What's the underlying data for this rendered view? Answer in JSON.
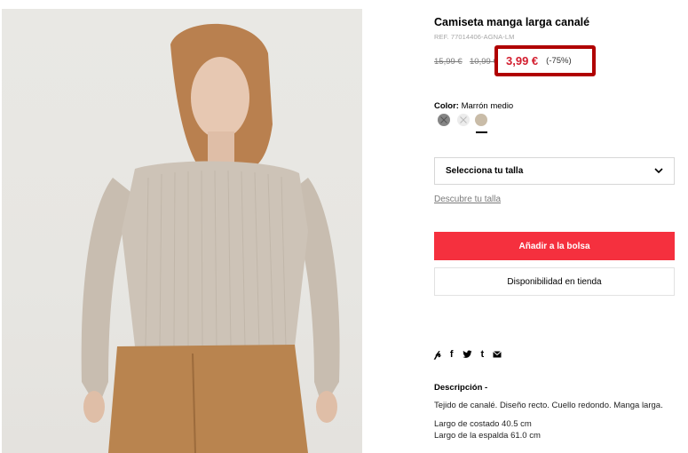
{
  "product": {
    "title": "Camiseta manga larga canalé",
    "ref": "REF. 77014406-AGNA-LM",
    "price_original": "15,99 €",
    "price_previous": "10,99 €",
    "price_current": "3,99 €",
    "discount": "(-75%)"
  },
  "color": {
    "label": "Color:",
    "value": "Marrón medio",
    "swatches": [
      "#858585",
      "#ececec",
      "#c9bca8"
    ]
  },
  "size": {
    "select_label": "Selecciona tu talla",
    "discover_link": "Descubre tu talla"
  },
  "actions": {
    "add_to_bag": "Añadir a la bolsa",
    "store_availability": "Disponibilidad en tienda"
  },
  "share_icons": [
    "pinterest-icon",
    "facebook-icon",
    "twitter-icon",
    "tumblr-icon",
    "email-icon"
  ],
  "description": {
    "heading": "Descripción -",
    "line1": "Tejido de canalé. Diseño recto. Cuello redondo. Manga larga.",
    "line2": "Largo de costado 40.5 cm",
    "line3": "Largo de la espalda 61.0 cm"
  },
  "colors": {
    "accent_red": "#f5303e",
    "price_red": "#d31e2f",
    "highlight_box": "#b00000"
  }
}
